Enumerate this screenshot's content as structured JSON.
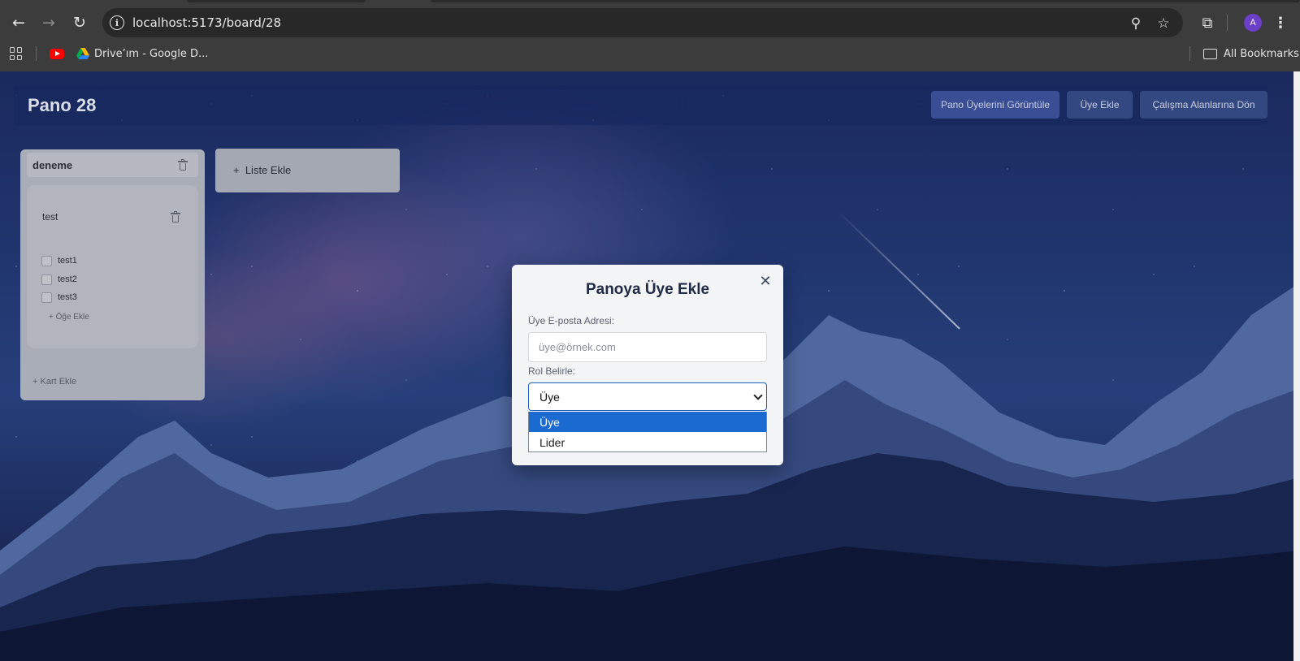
{
  "browser": {
    "url": "localhost:5173/board/28",
    "bookmarks": [
      {
        "label": "Drive’ım - Google D...",
        "icon": "google-drive-icon"
      }
    ],
    "all_bookmarks_label": "All Bookmarks",
    "profile_initial": "A"
  },
  "board": {
    "title": "Pano 28",
    "buttons": {
      "view_members": "Pano Üyelerini Görüntüle",
      "add_member": "Üye Ekle",
      "back_to_workspace": "Çalışma Alanlarına Dön"
    },
    "lists": [
      {
        "title": "deneme",
        "cards": [
          {
            "title": "test",
            "items": [
              "test1",
              "test2",
              "test3"
            ],
            "add_item_label": "Öğe Ekle"
          }
        ],
        "add_card_label": "Kart Ekle"
      }
    ],
    "add_list_label": "Liste Ekle"
  },
  "modal": {
    "title": "Panoya Üye Ekle",
    "email_label": "Üye E-posta Adresi:",
    "email_placeholder": "üye@örnek.com",
    "email_value": "",
    "role_label": "Rol Belirle:",
    "role_selected": "Üye",
    "role_options": [
      "Üye",
      "Lider"
    ]
  },
  "colors": {
    "accent": "#1b6ad2",
    "header_bg": "#182860",
    "modal_bg": "#f3f4f6"
  }
}
